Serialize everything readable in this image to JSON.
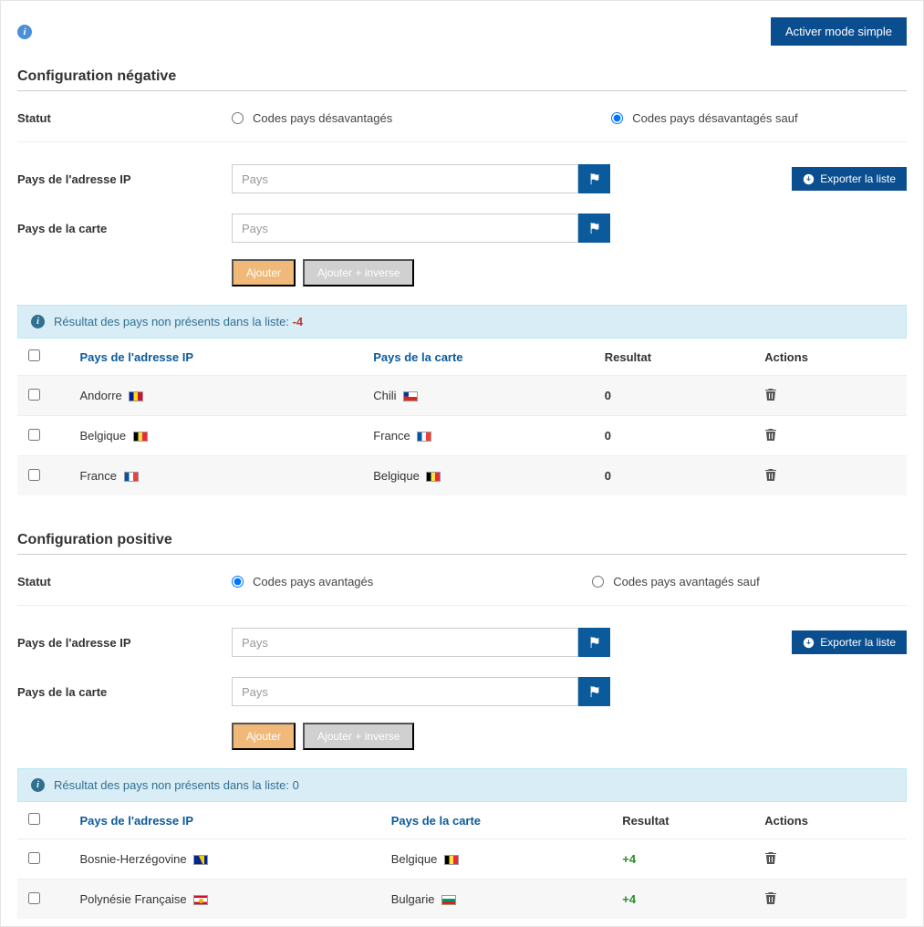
{
  "top": {
    "activate_simple": "Activer mode simple"
  },
  "neg": {
    "title": "Configuration négative",
    "status_label": "Statut",
    "radio_a": "Codes pays désavantagés",
    "radio_b": "Codes pays désavantagés sauf",
    "ip_label": "Pays de l'adresse IP",
    "carte_label": "Pays de la carte",
    "placeholder": "Pays",
    "export": "Exporter la liste",
    "add": "Ajouter",
    "add_inverse": "Ajouter + inverse",
    "banner_prefix": "Résultat des pays non présents dans la liste: ",
    "banner_val": "-4",
    "cols": {
      "check": "",
      "ip": "Pays de l'adresse IP",
      "carte": "Pays de la carte",
      "res": "Resultat",
      "act": "Actions"
    },
    "rows": [
      {
        "ip": "Andorre",
        "ip_flag": "flag-ad",
        "carte": "Chili",
        "carte_flag": "flag-cl",
        "res": "0"
      },
      {
        "ip": "Belgique",
        "ip_flag": "flag-be",
        "carte": "France",
        "carte_flag": "flag-fr",
        "res": "0"
      },
      {
        "ip": "France",
        "ip_flag": "flag-fr",
        "carte": "Belgique",
        "carte_flag": "flag-be",
        "res": "0"
      }
    ]
  },
  "pos": {
    "title": "Configuration positive",
    "status_label": "Statut",
    "radio_a": "Codes pays avantagés",
    "radio_b": "Codes pays avantagés sauf",
    "ip_label": "Pays de l'adresse IP",
    "carte_label": "Pays de la carte",
    "placeholder": "Pays",
    "export": "Exporter la liste",
    "add": "Ajouter",
    "add_inverse": "Ajouter + inverse",
    "banner_prefix": "Résultat des pays non présents dans la liste: ",
    "banner_val": "0",
    "cols": {
      "check": "",
      "ip": "Pays de l'adresse IP",
      "carte": "Pays de la carte",
      "res": "Resultat",
      "act": "Actions"
    },
    "rows": [
      {
        "ip": "Bosnie-Herzégovine",
        "ip_flag": "flag-ba",
        "carte": "Belgique",
        "carte_flag": "flag-be",
        "res": "+4"
      },
      {
        "ip": "Polynésie Française",
        "ip_flag": "flag-pf",
        "carte": "Bulgarie",
        "carte_flag": "flag-bg",
        "res": "+4"
      }
    ]
  }
}
